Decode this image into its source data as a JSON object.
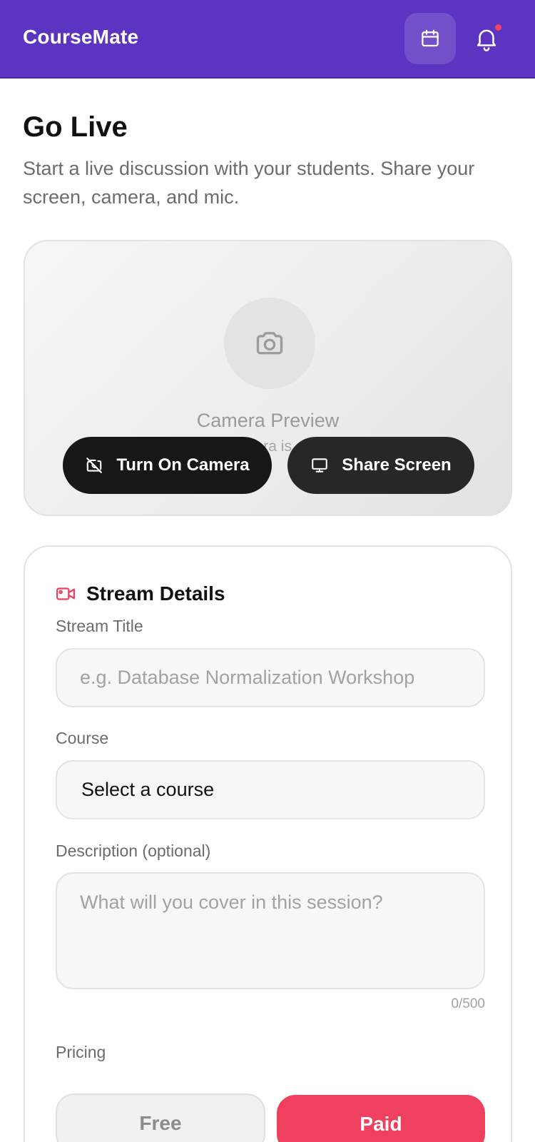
{
  "app": {
    "name": "CourseMate"
  },
  "header": {
    "calendar_icon": "calendar-icon",
    "notification_icon": "bell-icon",
    "accent": "#5b34c1"
  },
  "page": {
    "title": "Go Live",
    "subtitle": "Start a live discussion with your students. Share your screen, camera, and mic."
  },
  "preview": {
    "icon": "camera-icon",
    "title": "Camera Preview",
    "subtitle": "Camera is off",
    "camera_button": "Turn On Camera",
    "share_button": "Share Screen"
  },
  "stream_details": {
    "title": "Stream Details",
    "stream_title_label": "Stream Title",
    "stream_title_placeholder": "e.g. Database Normalization Workshop",
    "course_label": "Course",
    "course_value": "Select a course",
    "description_label": "Description (optional)",
    "description_placeholder": "What will you cover in this session?",
    "description_counter": "0/500",
    "pricing_label": "Pricing",
    "pricing_options": [
      "Free",
      "Paid"
    ],
    "pricing_selected": "Paid",
    "accent": "#f0405f"
  }
}
